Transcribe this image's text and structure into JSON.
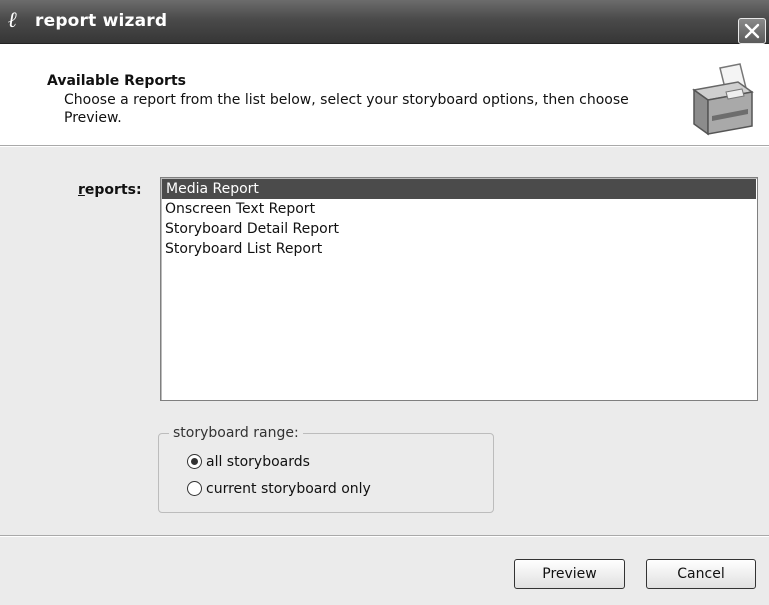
{
  "window": {
    "title": "report wizard",
    "logo_glyph": "ℓ",
    "close_icon": "close-x"
  },
  "header": {
    "title": "Available Reports",
    "description": "Choose a report from the list below, select your storyboard options, then choose Preview.",
    "icon": "printer-icon"
  },
  "reports": {
    "label_mnemonic": "r",
    "label_rest": "eports:",
    "items": [
      {
        "label": "Media Report",
        "selected": true
      },
      {
        "label": "Onscreen Text Report",
        "selected": false
      },
      {
        "label": "Storyboard Detail Report",
        "selected": false
      },
      {
        "label": "Storyboard List Report",
        "selected": false
      }
    ]
  },
  "storyboard_range": {
    "legend": "storyboard range:",
    "options": [
      {
        "label": "all storyboards",
        "checked": true
      },
      {
        "label": "current storyboard only",
        "checked": false
      }
    ]
  },
  "buttons": {
    "preview": "Preview",
    "cancel": "Cancel"
  },
  "colors": {
    "titlebar": "#4a4a4a",
    "selection": "#4b4b4b",
    "panel": "#ebebeb"
  }
}
